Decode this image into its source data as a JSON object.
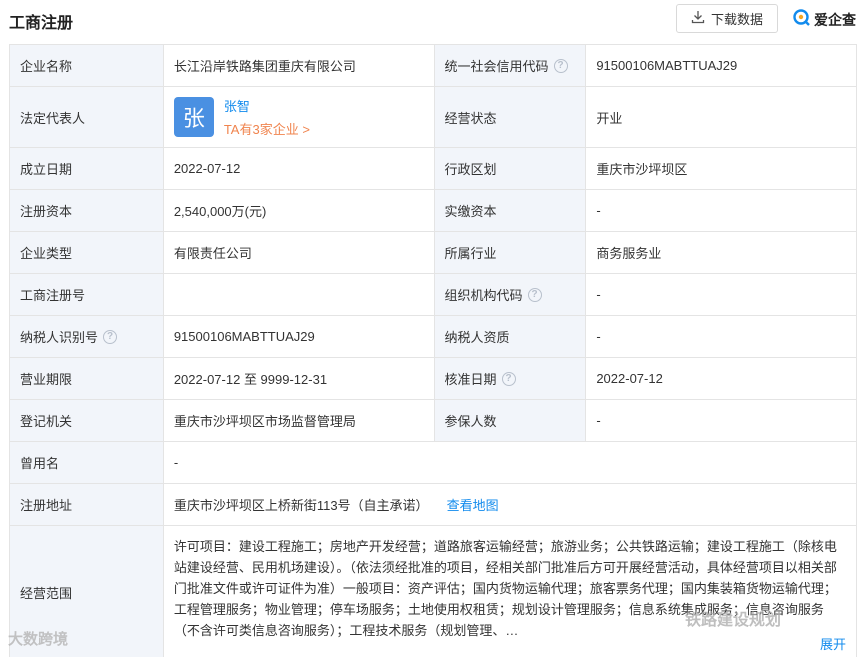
{
  "header": {
    "title": "工商注册",
    "download_label": "下载数据",
    "brand_label": "爱企查"
  },
  "rows": {
    "r1": {
      "l1": "企业名称",
      "v1": "长江沿岸铁路集团重庆有限公司",
      "l2": "统一社会信用代码",
      "v2": "91500106MABTTUAJ29"
    },
    "r2": {
      "l1": "法定代表人",
      "avatar_char": "张",
      "name": "张智",
      "sub": "TA有3家企业 >",
      "l2": "经营状态",
      "v2": "开业"
    },
    "r3": {
      "l1": "成立日期",
      "v1": "2022-07-12",
      "l2": "行政区划",
      "v2": "重庆市沙坪坝区"
    },
    "r4": {
      "l1": "注册资本",
      "v1": "2,540,000万(元)",
      "l2": "实缴资本",
      "v2": "-"
    },
    "r5": {
      "l1": "企业类型",
      "v1": "有限责任公司",
      "l2": "所属行业",
      "v2": "商务服务业"
    },
    "r6": {
      "l1": "工商注册号",
      "v1": "",
      "l2": "组织机构代码",
      "v2": "-"
    },
    "r7": {
      "l1": "纳税人识别号",
      "v1": "91500106MABTTUAJ29",
      "l2": "纳税人资质",
      "v2": "-"
    },
    "r8": {
      "l1": "营业期限",
      "v1": "2022-07-12 至 9999-12-31",
      "l2": "核准日期",
      "v2": "2022-07-12"
    },
    "r9": {
      "l1": "登记机关",
      "v1": "重庆市沙坪坝区市场监督管理局",
      "l2": "参保人数",
      "v2": "-"
    },
    "r10": {
      "l1": "曾用名",
      "v1": "-"
    },
    "r11": {
      "l1": "注册地址",
      "v1": "重庆市沙坪坝区上桥新街113号（自主承诺）",
      "link": "查看地图"
    },
    "r12": {
      "l1": "经营范围",
      "v1": "许可项目：建设工程施工；房地产开发经营；道路旅客运输经营；旅游业务；公共铁路运输；建设工程施工（除核电站建设经营、民用机场建设）。（依法须经批准的项目，经相关部门批准后方可开展经营活动，具体经营项目以相关部门批准文件或许可证件为准）一般项目：资产评估；国内货物运输代理；旅客票务代理；国内集装箱货物运输代理；工程管理服务；物业管理；停车场服务；土地使用权租赁；规划设计管理服务；信息系统集成服务；信息咨询服务（不含许可类信息咨询服务）；工程技术服务（规划管理、…",
      "expand": "展开"
    }
  },
  "watermarks": {
    "left": "大数跨境",
    "right": "铁路建设规划"
  },
  "colors": {
    "link": "#128bed",
    "label_bg": "#f2f5fa",
    "accent_orange": "#f0844e",
    "avatar_bg": "#4a90e2"
  }
}
